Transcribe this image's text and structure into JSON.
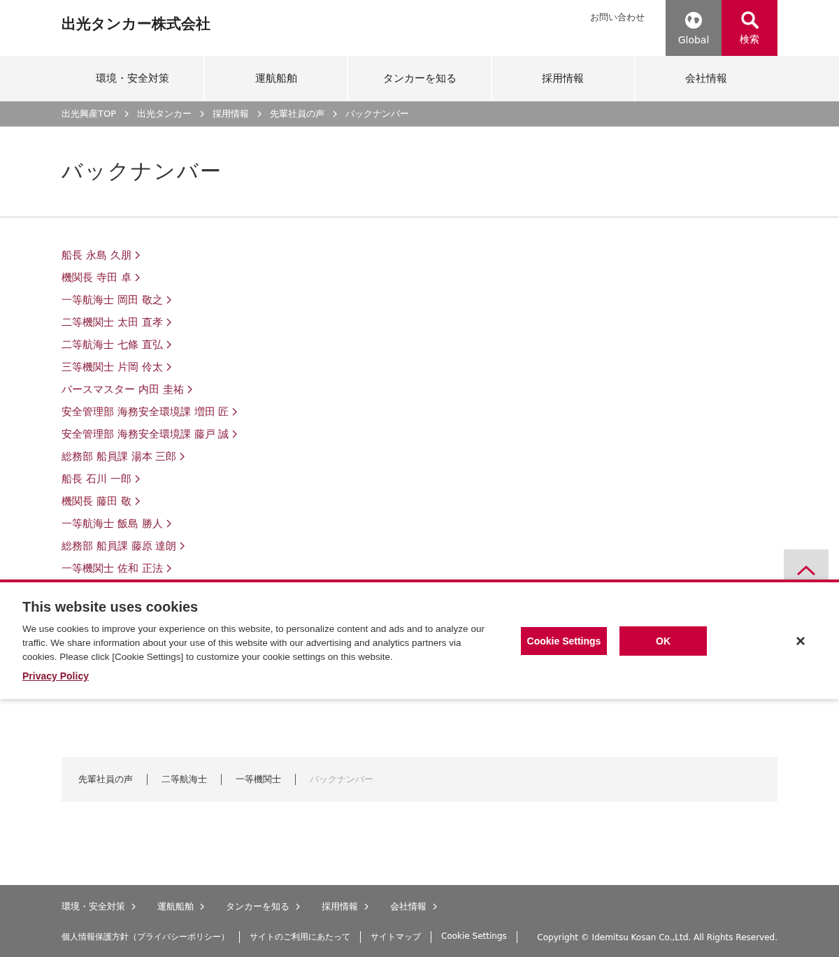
{
  "header": {
    "logo": "出光タンカー株式会社",
    "contact_link": "お問い合わせ",
    "global_button": "Global",
    "search_button": "検索"
  },
  "nav": [
    {
      "label": "環境・安全対策"
    },
    {
      "label": "運航船舶"
    },
    {
      "label": "タンカーを知る"
    },
    {
      "label": "採用情報"
    },
    {
      "label": "会社情報"
    }
  ],
  "breadcrumb": [
    "出光興産TOP",
    "出光タンカー",
    "採用情報",
    "先輩社員の声",
    "バックナンバー"
  ],
  "page_title": "バックナンバー",
  "links": [
    "船長 永島 久朋",
    "機関長 寺田 卓",
    "一等航海士 岡田 敬之",
    "二等機関士 太田 直孝",
    "二等航海士 七條 直弘",
    "三等機関士 片岡 伶太",
    "バースマスター 内田 圭祐",
    "安全管理部 海務安全環境課 増田 匠",
    "安全管理部 海務安全環境課 藤戸 誠",
    "総務部 船員課 湯本 三郎",
    "船長 石川 一郎",
    "機関長 藤田 敬",
    "一等航海士 飯島 勝人",
    "総務部 船員課 藤原 達朗",
    "一等機関士 佐和 正法"
  ],
  "sub_nav": [
    {
      "label": "先輩社員の声",
      "selected": false
    },
    {
      "label": "二等航海士",
      "selected": false
    },
    {
      "label": "一等機関士",
      "selected": false
    },
    {
      "label": "バックナンバー",
      "selected": true
    }
  ],
  "footer": {
    "nav": [
      "環境・安全対策",
      "運航船舶",
      "タンカーを知る",
      "採用情報",
      "会社情報"
    ],
    "links": [
      "個人情報保護方針（プライバシーポリシー）",
      "サイトのご利用にあたって",
      "サイトマップ",
      "Cookie Settings"
    ],
    "copyright": "Copyright © Idemitsu Kosan Co.,Ltd. All Rights Reserved."
  },
  "cookie_banner": {
    "title": "This website uses cookies",
    "text": "We use cookies to improve your experience on this website, to personalize content and ads and to analyze our traffic. We share information about your use of this website with our advertising and analytics partners via cookies. Please click [Cookie Settings] to customize your cookie settings on this website.",
    "privacy_link": "Privacy Policy",
    "settings_button": "Cookie Settings",
    "ok_button": "OK",
    "close": "×"
  }
}
